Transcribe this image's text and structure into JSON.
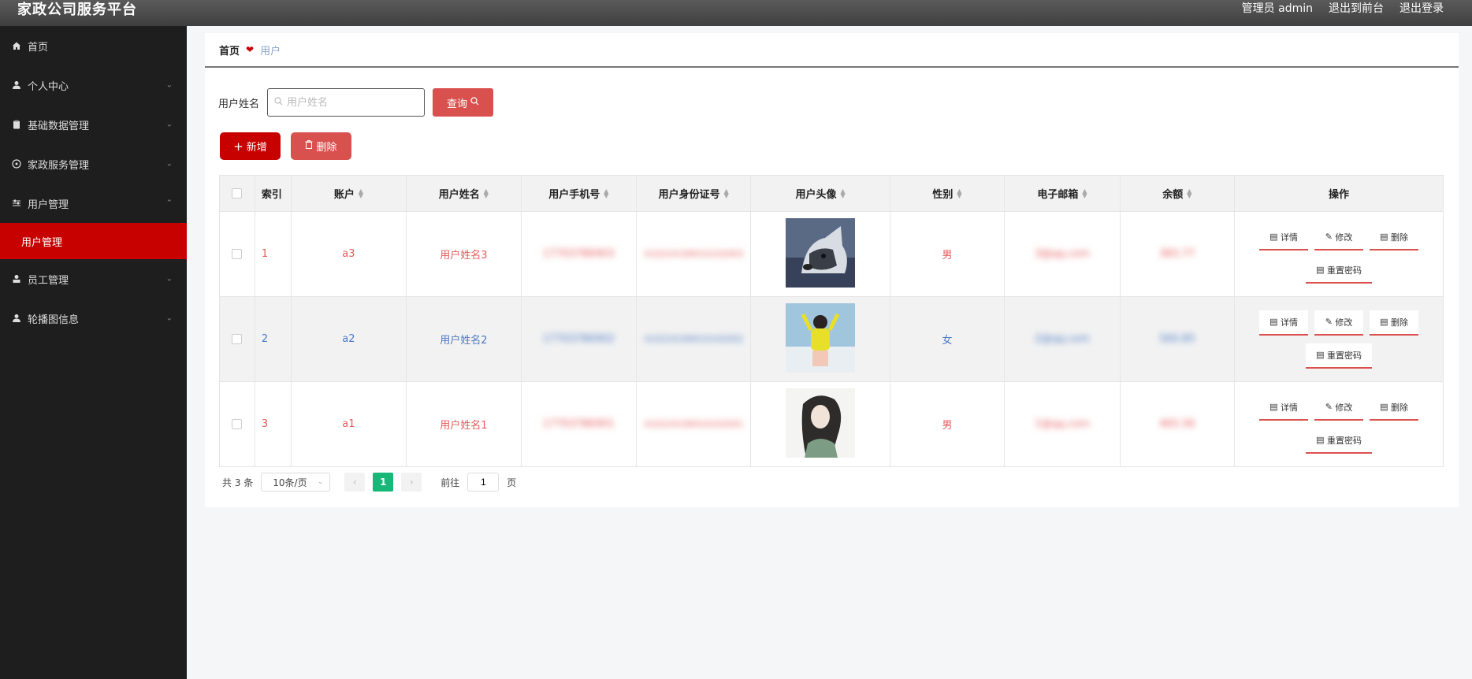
{
  "app": {
    "title": "家政公司服务平台"
  },
  "topbar": {
    "admin": "管理员 admin",
    "front": "退出到前台",
    "logout": "退出登录"
  },
  "sidebar": {
    "items": [
      {
        "label": "首页"
      },
      {
        "label": "个人中心"
      },
      {
        "label": "基础数据管理"
      },
      {
        "label": "家政服务管理"
      },
      {
        "label": "用户管理"
      },
      {
        "label": "员工管理"
      },
      {
        "label": "轮播图信息"
      }
    ],
    "submenu": "用户管理"
  },
  "breadcrumb": {
    "home": "首页",
    "current": "用户"
  },
  "search": {
    "label": "用户姓名",
    "placeholder": "用户姓名",
    "button": "查询"
  },
  "actions": {
    "add": "新增",
    "delete": "删除"
  },
  "table": {
    "headers": [
      "索引",
      "账户",
      "用户姓名",
      "用户手机号",
      "用户身份证号",
      "用户头像",
      "性别",
      "电子邮箱",
      "余额",
      "操作"
    ],
    "rows": [
      {
        "index": "1",
        "account": "a3",
        "name": "用户姓名3",
        "phone": "17703786903",
        "idcard": "410224199010102003",
        "sex": "男",
        "email": "3@qq.com",
        "balance": "383.77"
      },
      {
        "index": "2",
        "account": "a2",
        "name": "用户姓名2",
        "phone": "17703786902",
        "idcard": "410224199010102002",
        "sex": "女",
        "email": "2@qq.com",
        "balance": "560.85"
      },
      {
        "index": "3",
        "account": "a1",
        "name": "用户姓名1",
        "phone": "17703786901",
        "idcard": "410224199010102001",
        "sex": "男",
        "email": "1@qq.com",
        "balance": "465.56"
      }
    ],
    "ops": {
      "detail": "详情",
      "edit": "修改",
      "delete": "删除",
      "reset": "重置密码"
    }
  },
  "pager": {
    "total": "共 3 条",
    "page_size": "10条/页",
    "current": "1",
    "goto": "前往",
    "goto_value": "1",
    "page_suffix": "页"
  },
  "colors": {
    "accent": "#c70000",
    "danger": "#d9514e",
    "sidebar_bg": "#1e1e1e",
    "pager_active": "#16b777"
  }
}
